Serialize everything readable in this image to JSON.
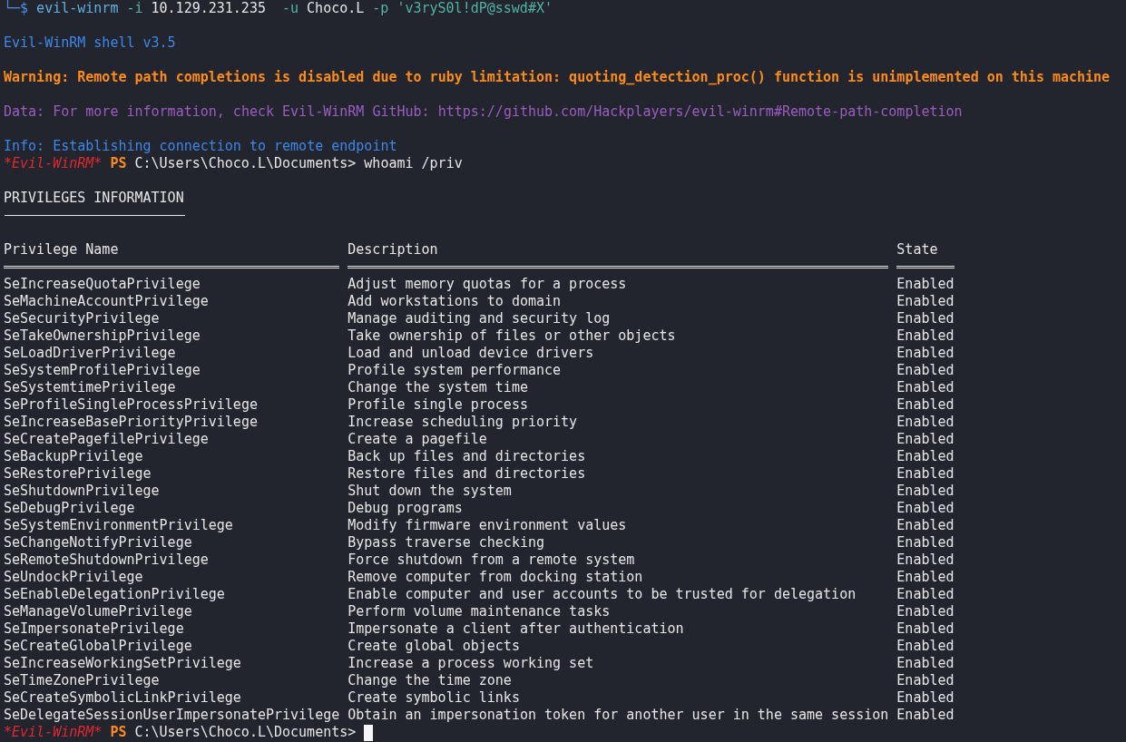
{
  "command_line": {
    "prompt": "└─$",
    "segments": [
      {
        "text": "evil-winrm",
        "kind": "command"
      },
      {
        "text": "-i",
        "kind": "flag"
      },
      {
        "text": "10.129.231.235 ",
        "kind": "arg"
      },
      {
        "text": "-u",
        "kind": "flag"
      },
      {
        "text": "Choco.L",
        "kind": "arg"
      },
      {
        "text": "-p",
        "kind": "flag"
      },
      {
        "text": "'v3ryS0l!dP@sswd#X'",
        "kind": "string"
      }
    ]
  },
  "messages": [
    {
      "kind": "banner",
      "text": "Evil-WinRM shell v3.5"
    },
    {
      "kind": "warning",
      "text": "Warning: Remote path completions is disabled due to ruby limitation: quoting_detection_proc() function is unimplemented on this machine"
    },
    {
      "kind": "data",
      "text": "Data: For more information, check Evil-WinRM GitHub: https://github.com/Hackplayers/evil-winrm#Remote-path-completion"
    },
    {
      "kind": "info",
      "text": "Info: Establishing connection to remote endpoint"
    }
  ],
  "prompts": [
    {
      "tag": "*Evil-WinRM*",
      "shell": "PS",
      "path": "C:\\Users\\Choco.L\\Documents>",
      "command": "whoami /priv",
      "cursor": false
    },
    {
      "tag": "*Evil-WinRM*",
      "shell": "PS",
      "path": "C:\\Users\\Choco.L\\Documents>",
      "cursor": true
    }
  ],
  "output": {
    "title": "PRIVILEGES INFORMATION",
    "columns": [
      "Privilege Name",
      "Description",
      "State"
    ],
    "rows": [
      [
        "SeIncreaseQuotaPrivilege",
        "Adjust memory quotas for a process",
        "Enabled"
      ],
      [
        "SeMachineAccountPrivilege",
        "Add workstations to domain",
        "Enabled"
      ],
      [
        "SeSecurityPrivilege",
        "Manage auditing and security log",
        "Enabled"
      ],
      [
        "SeTakeOwnershipPrivilege",
        "Take ownership of files or other objects",
        "Enabled"
      ],
      [
        "SeLoadDriverPrivilege",
        "Load and unload device drivers",
        "Enabled"
      ],
      [
        "SeSystemProfilePrivilege",
        "Profile system performance",
        "Enabled"
      ],
      [
        "SeSystemtimePrivilege",
        "Change the system time",
        "Enabled"
      ],
      [
        "SeProfileSingleProcessPrivilege",
        "Profile single process",
        "Enabled"
      ],
      [
        "SeIncreaseBasePriorityPrivilege",
        "Increase scheduling priority",
        "Enabled"
      ],
      [
        "SeCreatePagefilePrivilege",
        "Create a pagefile",
        "Enabled"
      ],
      [
        "SeBackupPrivilege",
        "Back up files and directories",
        "Enabled"
      ],
      [
        "SeRestorePrivilege",
        "Restore files and directories",
        "Enabled"
      ],
      [
        "SeShutdownPrivilege",
        "Shut down the system",
        "Enabled"
      ],
      [
        "SeDebugPrivilege",
        "Debug programs",
        "Enabled"
      ],
      [
        "SeSystemEnvironmentPrivilege",
        "Modify firmware environment values",
        "Enabled"
      ],
      [
        "SeChangeNotifyPrivilege",
        "Bypass traverse checking",
        "Enabled"
      ],
      [
        "SeRemoteShutdownPrivilege",
        "Force shutdown from a remote system",
        "Enabled"
      ],
      [
        "SeUndockPrivilege",
        "Remove computer from docking station",
        "Enabled"
      ],
      [
        "SeEnableDelegationPrivilege",
        "Enable computer and user accounts to be trusted for delegation",
        "Enabled"
      ],
      [
        "SeManageVolumePrivilege",
        "Perform volume maintenance tasks",
        "Enabled"
      ],
      [
        "SeImpersonatePrivilege",
        "Impersonate a client after authentication",
        "Enabled"
      ],
      [
        "SeCreateGlobalPrivilege",
        "Create global objects",
        "Enabled"
      ],
      [
        "SeIncreaseWorkingSetPrivilege",
        "Increase a process working set",
        "Enabled"
      ],
      [
        "SeTimeZonePrivilege",
        "Change the time zone",
        "Enabled"
      ],
      [
        "SeCreateSymbolicLinkPrivilege",
        "Create symbolic links",
        "Enabled"
      ],
      [
        "SeDelegateSessionUserImpersonatePrivilege",
        "Obtain an impersonation token for another user in the same session",
        "Enabled"
      ]
    ]
  }
}
